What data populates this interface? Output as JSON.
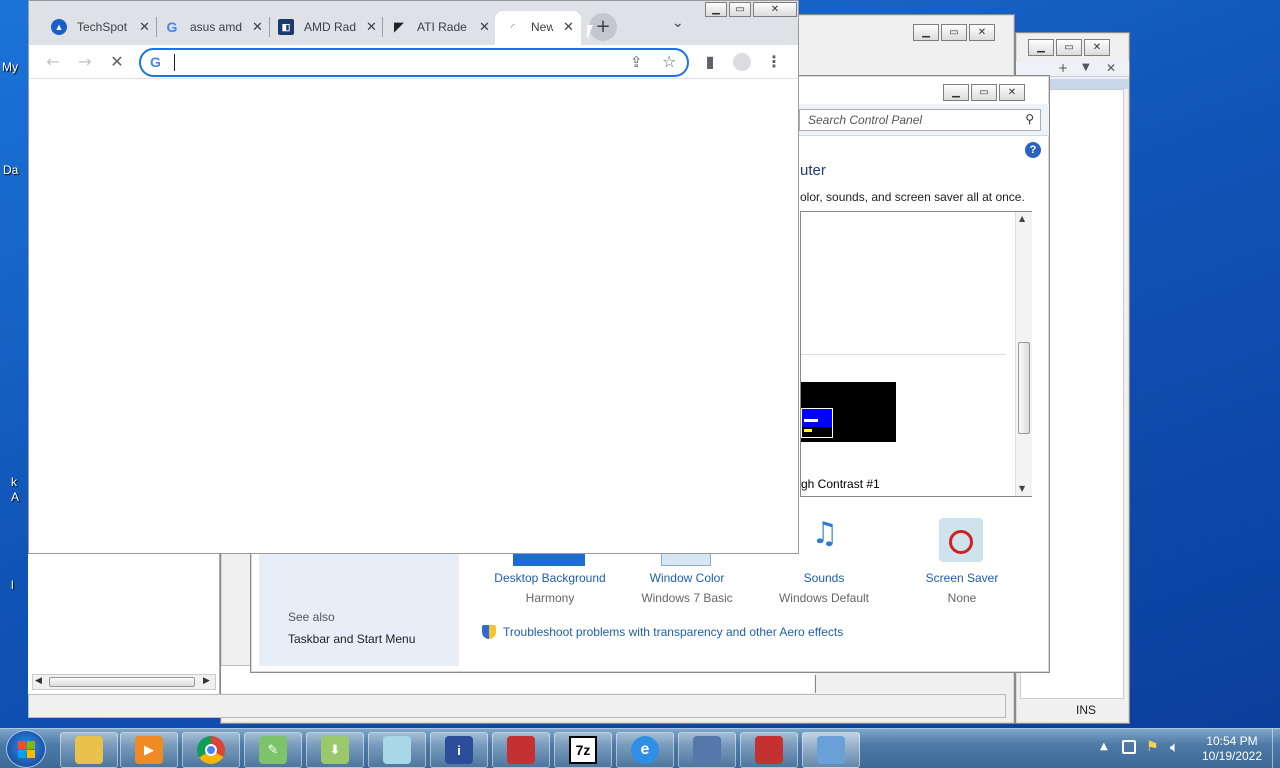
{
  "desktop": {
    "labels": [
      "My",
      "Da",
      "k",
      "A",
      "l"
    ]
  },
  "chrome": {
    "tabs": [
      {
        "title": "TechSpot",
        "icon": "techspot-icon"
      },
      {
        "title": "asus amd",
        "icon": "google-icon"
      },
      {
        "title": "AMD Rad",
        "icon": "amd-icon"
      },
      {
        "title": "ATI Rade",
        "icon": "ati-icon"
      },
      {
        "title": "New",
        "icon": "loading-icon"
      }
    ],
    "omnibox_value": ""
  },
  "control_panel": {
    "search_placeholder": "Search Control Panel",
    "heading_fragment": "uter",
    "subheading_fragment": "olor, sounds, and screen saver all at once.",
    "theme_fragment": "gh Contrast #1",
    "items": [
      {
        "label": "Desktop Background",
        "value": "Harmony"
      },
      {
        "label": "Window Color",
        "value": "Windows 7 Basic"
      },
      {
        "label": "Sounds",
        "value": "Windows Default"
      },
      {
        "label": "Screen Saver",
        "value": "None"
      }
    ],
    "see_also": "See also",
    "see_also_link": "Taskbar and Start Menu",
    "troubleshoot": "Troubleshoot problems with transparency and other Aero effects"
  },
  "statusbar": {
    "ins": "INS"
  },
  "clock": {
    "time": "10:54 PM",
    "date": "10/19/2022"
  },
  "colors": {
    "accent": "#1a73e8",
    "link": "#1e5fa8",
    "desktop": "#1565c8"
  }
}
